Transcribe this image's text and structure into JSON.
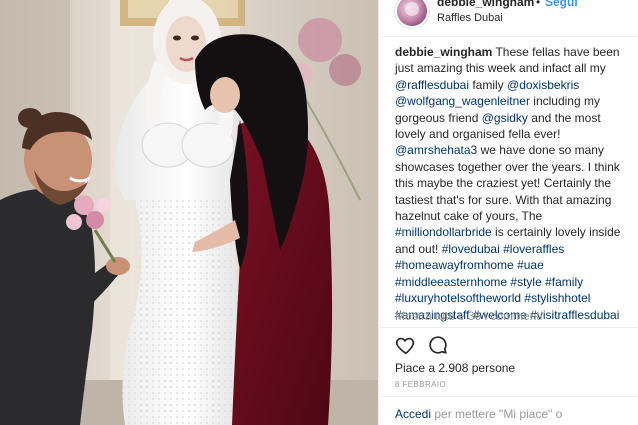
{
  "header": {
    "username": "debbie_wingham",
    "separator": "•",
    "follow_label": "Segui",
    "location": "Raffles Dubai"
  },
  "caption": {
    "author": "debbie_wingham",
    "segments": [
      {
        "type": "text",
        "value": " These fellas have been just amazing this week and infact all my "
      },
      {
        "type": "tag",
        "value": "@rafflesdubai"
      },
      {
        "type": "text",
        "value": " family "
      },
      {
        "type": "tag",
        "value": "@doxisbekris"
      },
      {
        "type": "text",
        "value": " "
      },
      {
        "type": "tag",
        "value": "@wolfgang_wagenleitner"
      },
      {
        "type": "text",
        "value": " including my gorgeous friend "
      },
      {
        "type": "tag",
        "value": "@gsidky"
      },
      {
        "type": "text",
        "value": " and the most lovely and organised fella ever! "
      },
      {
        "type": "tag",
        "value": "@amrshehata3"
      },
      {
        "type": "text",
        "value": " we have done so many showcases together over the years. I think this maybe the craziest yet! Certainly the tastiest that's for sure. With that amazing hazelnut cake of yours, The "
      },
      {
        "type": "tag",
        "value": "#milliondollarbride"
      },
      {
        "type": "text",
        "value": " is certainly lovely inside and out! "
      },
      {
        "type": "tag",
        "value": "#lovedubai"
      },
      {
        "type": "text",
        "value": " "
      },
      {
        "type": "tag",
        "value": "#loveraffles"
      },
      {
        "type": "text",
        "value": " "
      },
      {
        "type": "tag",
        "value": "#homeawayfromhome"
      },
      {
        "type": "text",
        "value": " "
      },
      {
        "type": "tag",
        "value": "#uae"
      },
      {
        "type": "text",
        "value": " "
      },
      {
        "type": "tag",
        "value": "#middleeasternhome"
      },
      {
        "type": "text",
        "value": " "
      },
      {
        "type": "tag",
        "value": "#style"
      },
      {
        "type": "text",
        "value": " "
      },
      {
        "type": "tag",
        "value": "#family"
      },
      {
        "type": "text",
        "value": " "
      },
      {
        "type": "tag",
        "value": "#luxuryhotelsoftheworld"
      },
      {
        "type": "text",
        "value": " "
      },
      {
        "type": "tag",
        "value": "#stylishhotel"
      },
      {
        "type": "text",
        "value": " "
      },
      {
        "type": "tag",
        "value": "#amazingstaff"
      },
      {
        "type": "text",
        "value": " "
      },
      {
        "type": "tag",
        "value": "#welcome"
      },
      {
        "type": "text",
        "value": " "
      },
      {
        "type": "tag",
        "value": "#visitrafflesdubai"
      }
    ]
  },
  "comments": {
    "view_all_label": "Mostra tutti e 36 i commenti"
  },
  "actions": {
    "like_icon": "heart-icon",
    "comment_icon": "comment-bubble-icon"
  },
  "stats": {
    "likes_label": "Piace a 2.908 persone",
    "date_label": "8 FEBBRAIO"
  },
  "login": {
    "link_label": "Accedi",
    "rest_label": " per mettere \"Mi piace\" o"
  },
  "colors": {
    "link_blue": "#3897f0",
    "hashtag_navy": "#003569",
    "muted_gray": "#999999"
  }
}
